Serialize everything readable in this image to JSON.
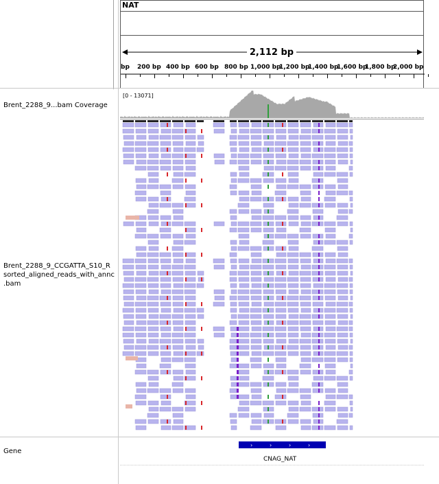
{
  "locus": {
    "name": "NAT"
  },
  "ruler": {
    "span_label": "2,112 bp",
    "tick_labels": [
      "bp",
      "200 bp",
      "400 bp",
      "600 bp",
      "800 bp",
      "1,000 bp",
      "1,200 bp",
      "1,400 bp",
      "1,600 bp",
      "1,800 bp",
      "2,000 bp"
    ]
  },
  "tracks": {
    "coverage_label": "Brent_2288_9...bam Coverage",
    "coverage_range": "[0 - 13071]",
    "alignment_label_lines": [
      "Brent_2288_9_CCGATTA_S10_R",
      "sorted_aligned_reads_with_annc",
      ".bam"
    ],
    "gene_label": "Gene",
    "gene_name": "CNAG_NAT"
  },
  "colors": {
    "read": "#b8b4ee",
    "read_stroke": "#9a96d8",
    "coverage": "#a8a8a8",
    "gene": "#0000b2",
    "mismatch_red": "#d8262a",
    "mismatch_green": "#2e9e3a",
    "mismatch_blue": "#2a3fd8",
    "insertion": "#7a1fc9",
    "clip": "#e9b5a8"
  }
}
